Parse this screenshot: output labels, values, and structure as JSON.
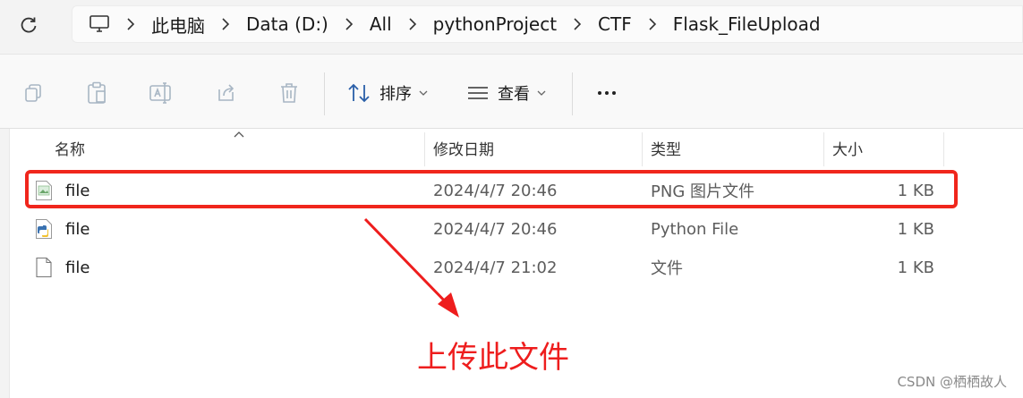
{
  "breadcrumb": [
    "此电脑",
    "Data (D:)",
    "All",
    "pythonProject",
    "CTF",
    "Flask_FileUpload"
  ],
  "toolbar": {
    "sort_label": "排序",
    "view_label": "查看"
  },
  "columns": [
    "名称",
    "修改日期",
    "类型",
    "大小"
  ],
  "files": [
    {
      "name": "file",
      "modified": "2024/4/7 20:46",
      "type": "PNG 图片文件",
      "size": "1 KB",
      "icon": "png-file-icon"
    },
    {
      "name": "file",
      "modified": "2024/4/7 20:46",
      "type": "Python File",
      "size": "1 KB",
      "icon": "python-file-icon"
    },
    {
      "name": "file",
      "modified": "2024/4/7 21:02",
      "type": "文件",
      "size": "1 KB",
      "icon": "generic-file-icon"
    }
  ],
  "annotation": {
    "text": "上传此文件",
    "color": "#f0261c"
  },
  "watermark": "CSDN @栖栖故人"
}
